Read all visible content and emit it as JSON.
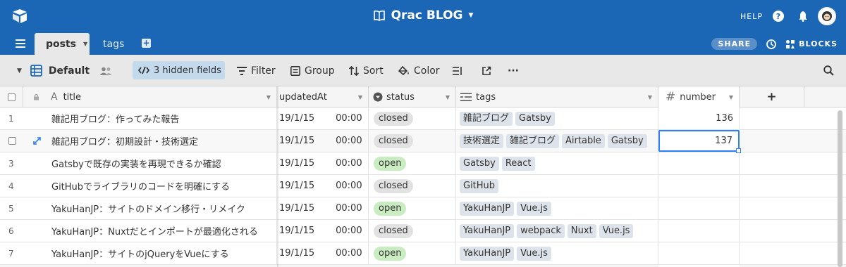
{
  "header": {
    "base_title": "Qrac BLOG",
    "help_label": "HELP",
    "help_glyph": "?"
  },
  "tabs": {
    "active": "posts",
    "other": "tags",
    "share_label": "SHARE",
    "blocks_label": "BLOCKS"
  },
  "toolbar": {
    "view_name": "Default",
    "hidden_fields": "3 hidden fields",
    "filter": "Filter",
    "group": "Group",
    "sort": "Sort",
    "color": "Color",
    "more": "···"
  },
  "columns": {
    "title": "title",
    "updatedAt": "updatedAt",
    "status": "status",
    "tags": "tags",
    "number": "number",
    "add": "+"
  },
  "rows": [
    {
      "num": "1",
      "title": "雑記用ブログ：作ってみた報告",
      "date": "19/1/15",
      "time": "00:00",
      "status": "closed",
      "tags": [
        "雑記ブログ",
        "Gatsby"
      ],
      "number": "136"
    },
    {
      "num": "",
      "title": "雑記用ブログ：初期設計・技術選定",
      "date": "19/1/15",
      "time": "00:00",
      "status": "closed",
      "tags": [
        "技術選定",
        "雑記ブログ",
        "Airtable",
        "Gatsby"
      ],
      "number": "137"
    },
    {
      "num": "3",
      "title": "Gatsbyで既存の実装を再現できるか確認",
      "date": "19/1/15",
      "time": "00:00",
      "status": "open",
      "tags": [
        "Gatsby",
        "React"
      ],
      "number": ""
    },
    {
      "num": "4",
      "title": "GitHubでライブラリのコードを明確にする",
      "date": "19/1/15",
      "time": "00:00",
      "status": "closed",
      "tags": [
        "GitHub"
      ],
      "number": ""
    },
    {
      "num": "5",
      "title": "YakuHanJP：サイトのドメイン移行・リメイク",
      "date": "19/1/15",
      "time": "00:00",
      "status": "open",
      "tags": [
        "YakuHanJP",
        "Vue.js"
      ],
      "number": ""
    },
    {
      "num": "6",
      "title": "YakuHanJP：Nuxtだとインポートが最適化される",
      "date": "19/1/15",
      "time": "00:00",
      "status": "closed",
      "tags": [
        "YakuHanJP",
        "webpack",
        "Nuxt",
        "Vue.js"
      ],
      "number": ""
    },
    {
      "num": "7",
      "title": "YakuHanJP：サイトのjQueryをVueにする",
      "date": "19/1/15",
      "time": "00:00",
      "status": "open",
      "tags": [
        "YakuHanJP",
        "Vue.js"
      ],
      "number": ""
    }
  ],
  "colors": {
    "header_bg": "#1b66b5",
    "toolbar_bg": "#e8e8e8",
    "selection": "#2d7ff9",
    "open_pill": "#c9edc0",
    "closed_pill": "#e2e2e2"
  }
}
